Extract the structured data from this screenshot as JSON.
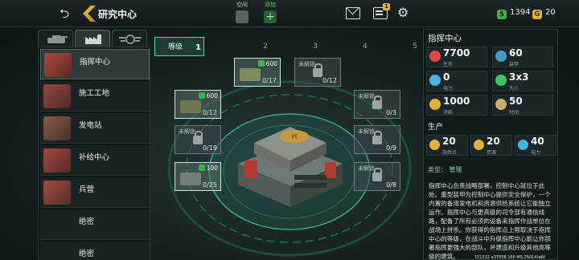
{
  "header": {
    "title": "研究中心",
    "slot1": "空闲",
    "slot2": "添加",
    "badge": "1"
  },
  "currency": {
    "cash": "1394",
    "gold": "20"
  },
  "levels": {
    "current_label": "等级",
    "current": "1",
    "next": [
      "2",
      "3",
      "4",
      "5"
    ]
  },
  "buildings": [
    {
      "name": "指挥中心",
      "color": "#9b3a2e"
    },
    {
      "name": "施工工地",
      "color": "#7a3a30"
    },
    {
      "name": "发电站",
      "color": "#6e4a38"
    },
    {
      "name": "补给中心",
      "color": "#7d3a33"
    },
    {
      "name": "兵营",
      "color": "#7b3c34"
    },
    {
      "name": "绝密",
      "color": ""
    },
    {
      "name": "绝密",
      "color": ""
    }
  ],
  "cards": {
    "locked_label": "未解锁",
    "c1": {
      "cost": "600",
      "count": "0/17"
    },
    "c2": {
      "count": "0/12"
    },
    "c3": {
      "cost": "600",
      "count": "0/12"
    },
    "c4": {
      "count": "0/3"
    },
    "c5": {
      "count": "0/19"
    },
    "c6": {
      "count": "0/9"
    },
    "c7": {
      "cost": "100",
      "count": "0/25"
    },
    "c8": {
      "count": "0/8"
    }
  },
  "panel": {
    "title": "指挥中心",
    "stats": [
      {
        "value": "7700",
        "label": "生命",
        "color": "#e04848"
      },
      {
        "value": "60",
        "label": "装甲",
        "color": "#3fa0c8"
      },
      {
        "value": "0",
        "label": "电力",
        "color": "#46b6e0"
      },
      {
        "value": "3x3",
        "label": "大小",
        "color": "#3fc26a"
      },
      {
        "value": "1000",
        "label": "消耗",
        "color": "#e0b238"
      },
      {
        "value": "50",
        "label": "时间",
        "color": "#c9b068"
      }
    ],
    "production_title": "生产",
    "production": [
      {
        "value": "20",
        "label": "指挥点",
        "color": "#e0b238"
      },
      {
        "value": "20",
        "label": "资源",
        "color": "#e0b238"
      },
      {
        "value": "40",
        "label": "电力",
        "color": "#46b6e0"
      }
    ],
    "type_label": "类型： 管理",
    "description": "指挥中心负责战略部署，控制中心就位于此处。重型装甲为控制中心提供安全保护，一个内置的备用发电机和资源供给系统让它能独立运作。指挥中心与更高级的司令部有通信线路，配备了所有必须的设备来指挥作战单位在战场上拼杀。你获得的指挥点上限取决于指挥中心的等级，在战斗中升级指挥中心能让你部署指挥更强大的部队，并建造和升级其他高等级的建筑。"
  },
  "footer": "151312 a37058 100 MS:25014!a6f"
}
